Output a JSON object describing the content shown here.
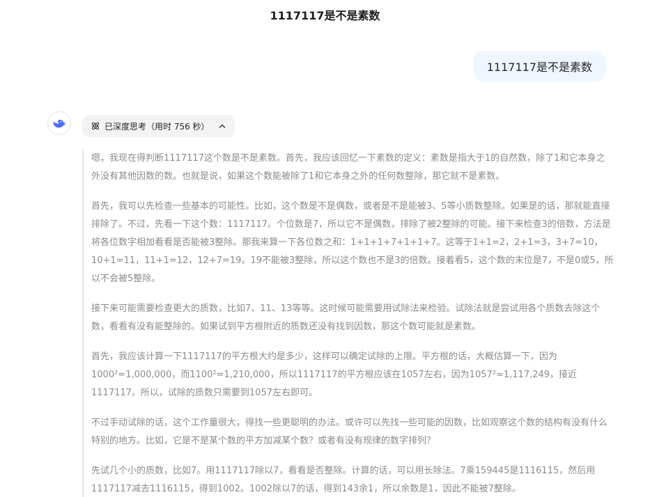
{
  "header": {
    "title": "1117117是不是素数"
  },
  "user_message": {
    "text": "1117117是不是素数"
  },
  "assistant": {
    "avatar_icon": "whale-logo-icon",
    "think_toggle": {
      "icon": "atom-icon",
      "label": "已深度思考（用时 756 秒）",
      "chevron_icon": "chevron-up-icon"
    },
    "thinking_paragraphs": [
      "嗯，我现在得判断1117117这个数是不是素数。首先，我应该回忆一下素数的定义：素数是指大于1的自然数，除了1和它本身之外没有其他因数的数。也就是说，如果这个数能被除了1和它本身之外的任何数整除，那它就不是素数。",
      "首先，我可以先检查一些基本的可能性。比如，这个数是不是偶数，或者是不是能被3、5等小质数整除。如果是的话，那就能直接排除了。不过，先看一下这个数：1117117。个位数是7，所以它不是偶数，排除了被2整除的可能。接下来检查3的倍数，方法是将各位数字相加看看是否能被3整除。那我来算一下各位数之和：1+1+1+7+1+1+7。这等于1+1=2，2+1=3，3+7=10，10+1=11，11+1=12，12+7=19。19不能被3整除，所以这个数也不是3的倍数。接着看5，这个数的末位是7，不是0或5，所以不会被5整除。",
      "接下来可能需要检查更大的质数，比如7、11、13等等。这时候可能需要用试除法来检验。试除法就是尝试用各个质数去除这个数，看看有没有能整除的。如果试到平方根附近的质数还没有找到因数，那这个数可能就是素数。",
      "首先，我应该计算一下1117117的平方根大约是多少，这样可以确定试除的上限。平方根的话，大概估算一下，因为1000²=1,000,000，而1100²=1,210,000，所以1117117的平方根应该在1057左右，因为1057²≈1,117,249，接近1117117。所以，试除的质数只需要到1057左右即可。",
      "不过手动试除的话，这个工作量很大，得找一些更聪明的办法。或许可以先找一些可能的因数，比如观察这个数的结构有没有什么特别的地方。比如，它是不是某个数的平方加减某个数？或者有没有规律的数字排列？",
      "先试几个小的质数，比如7。用1117117除以7，看看是否整除。计算的话，可以用长除法。7乘159445是1116115，然后用1117117减去1116115，得到1002。1002除以7的话，得到143余1，所以余数是1，因此不能被7整除。"
    ]
  }
}
